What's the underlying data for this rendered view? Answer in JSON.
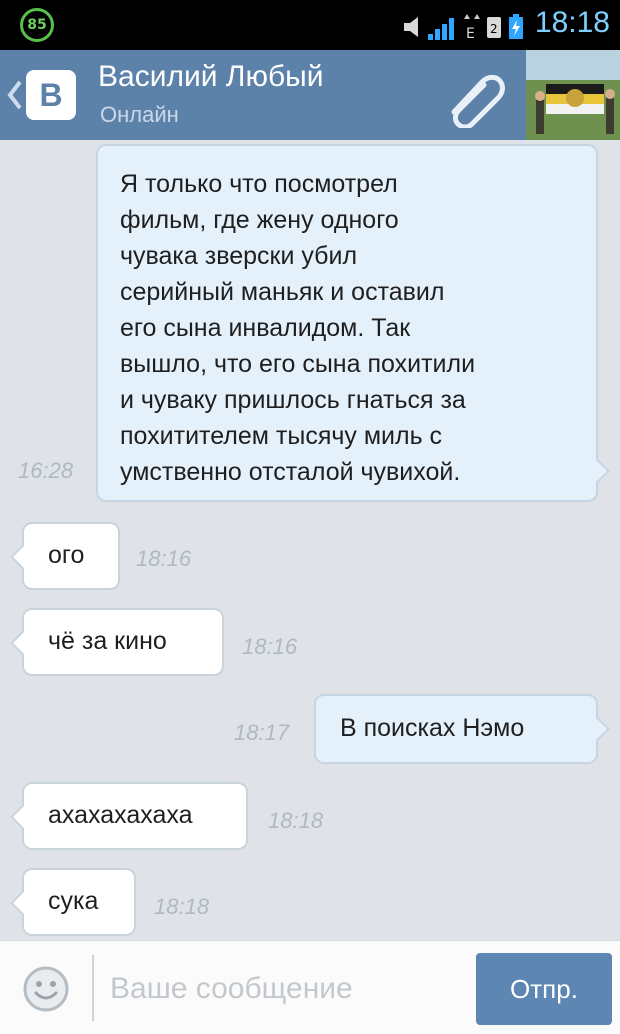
{
  "status_bar": {
    "battery_level": "85",
    "time": "18:18",
    "icons": [
      "battery-circle-icon",
      "speaker-icon",
      "signal-icon",
      "edge-data-icon",
      "sim-icon",
      "battery-icon"
    ]
  },
  "header": {
    "logo_letter": "B",
    "contact_name": "Василий Любый",
    "contact_status": "Онлайн",
    "attach_icon": "paperclip-icon",
    "accent_color": "#5d82aa"
  },
  "messages": [
    {
      "direction": "out",
      "text": "Я только что посмотрел\nфильм, где жену одного\nчувака зверски убил\nсерийный маньяк и оставил\nего сына инвалидом. Так\nвышло, что его сына похитили\nи чуваку пришлось гнаться за\nпохитителем тысячу миль с\nумственно отсталой чувихой.",
      "time": "16:28"
    },
    {
      "direction": "in",
      "text": "ого",
      "time": "18:16"
    },
    {
      "direction": "in",
      "text": "чё за кино",
      "time": "18:16"
    },
    {
      "direction": "out",
      "text": "В поисках Нэмо",
      "time": "18:17"
    },
    {
      "direction": "in",
      "text": "ахахахахаха",
      "time": "18:18"
    },
    {
      "direction": "in",
      "text": "сука",
      "time": "18:18"
    }
  ],
  "composer": {
    "placeholder": "Ваше сообщение",
    "value": "",
    "send_label": "Отпр.",
    "smile_icon": "smiley-icon"
  }
}
